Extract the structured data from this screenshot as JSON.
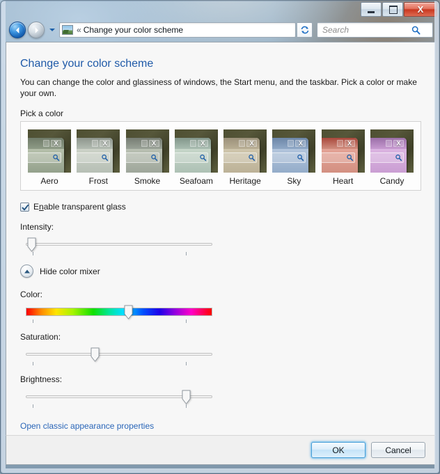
{
  "window": {
    "controls": {
      "minimize_label": "Minimize",
      "maximize_label": "Maximize",
      "close_label": "X"
    }
  },
  "navbar": {
    "back_label": "Back",
    "forward_label": "Forward",
    "recent_pages_label": "Recent pages",
    "address_icon": "picture-icon",
    "breadcrumb_chevron": "«",
    "breadcrumb_text": "Change your color scheme",
    "refresh_label": "Refresh",
    "search_placeholder": "Search"
  },
  "page": {
    "title": "Change your color scheme",
    "description": "You can change the color and glassiness of windows, the Start menu, and the taskbar. Pick a color or make your own.",
    "pick_color_label": "Pick a color"
  },
  "swatches": [
    {
      "name": "Aero",
      "frame": "#8e9b86",
      "title": "#6f7b69",
      "body": "#b6c0ab"
    },
    {
      "name": "Frost",
      "frame": "#b3bcb2",
      "title": "#8d958c",
      "body": "#ccd2c7"
    },
    {
      "name": "Smoke",
      "frame": "#9aa297",
      "title": "#767d73",
      "body": "#b9c0b2"
    },
    {
      "name": "Seafoam",
      "frame": "#a9bdb1",
      "title": "#82968a",
      "body": "#c6d6c9"
    },
    {
      "name": "Heritage",
      "frame": "#b9ae94",
      "title": "#9b917a",
      "body": "#cfc6ac"
    },
    {
      "name": "Sky",
      "frame": "#8fa8c6",
      "title": "#6d87a8",
      "body": "#b2c5dc"
    },
    {
      "name": "Heart",
      "frame": "#d08d7e",
      "title": "#a9483c",
      "body": "#e4a396"
    },
    {
      "name": "Candy",
      "frame": "#c79ad0",
      "title": "#9b6fa8",
      "body": "#dbb4e1"
    }
  ],
  "transparency": {
    "checkbox_checked": true,
    "label_prefix": "E",
    "label_accel": "n",
    "label_suffix": "able transparent glass"
  },
  "sliders": [
    {
      "id": "intensity",
      "label": "Intensity:",
      "value": 3,
      "type": "plain"
    },
    {
      "id": "color",
      "label": "Color:",
      "value": 55,
      "type": "hue"
    },
    {
      "id": "saturation",
      "label": "Saturation:",
      "value": 37,
      "type": "plain"
    },
    {
      "id": "brightness",
      "label": "Brightness:",
      "value": 86,
      "type": "plain"
    }
  ],
  "mixer": {
    "toggle_label": "Hide color mixer",
    "toggle_icon": "chevron-up-icon",
    "expanded": true
  },
  "links": {
    "classic_appearance": "Open classic appearance properties"
  },
  "buttons": {
    "ok": "OK",
    "cancel": "Cancel"
  },
  "colors": {
    "accent_link": "#2a66b8",
    "title_blue": "#1f5aa8",
    "content_bg": "#f7f7f7",
    "cmdbar_bg": "#f0f0f0"
  }
}
